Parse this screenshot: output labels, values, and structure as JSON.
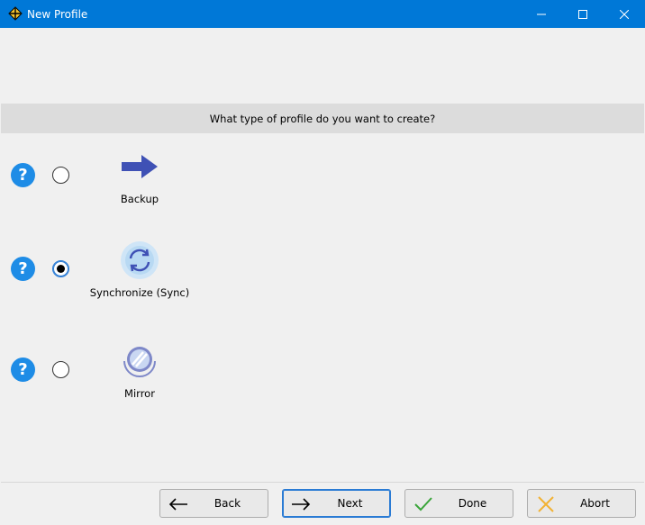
{
  "window": {
    "title": "New Profile",
    "app_icon": "freefilesync-icon"
  },
  "question": "What type of profile do you want to create?",
  "options": [
    {
      "label": "Backup",
      "selected": false,
      "icon": "arrow-right-icon"
    },
    {
      "label": "Synchronize (Sync)",
      "selected": true,
      "icon": "sync-icon"
    },
    {
      "label": "Mirror",
      "selected": false,
      "icon": "mirror-icon"
    }
  ],
  "buttons": {
    "back": "Back",
    "next": "Next",
    "done": "Done",
    "abort": "Abort"
  },
  "colors": {
    "titlebar": "#0078d7",
    "help": "#1e8ce6",
    "accent_icon": "#3f51b5"
  }
}
